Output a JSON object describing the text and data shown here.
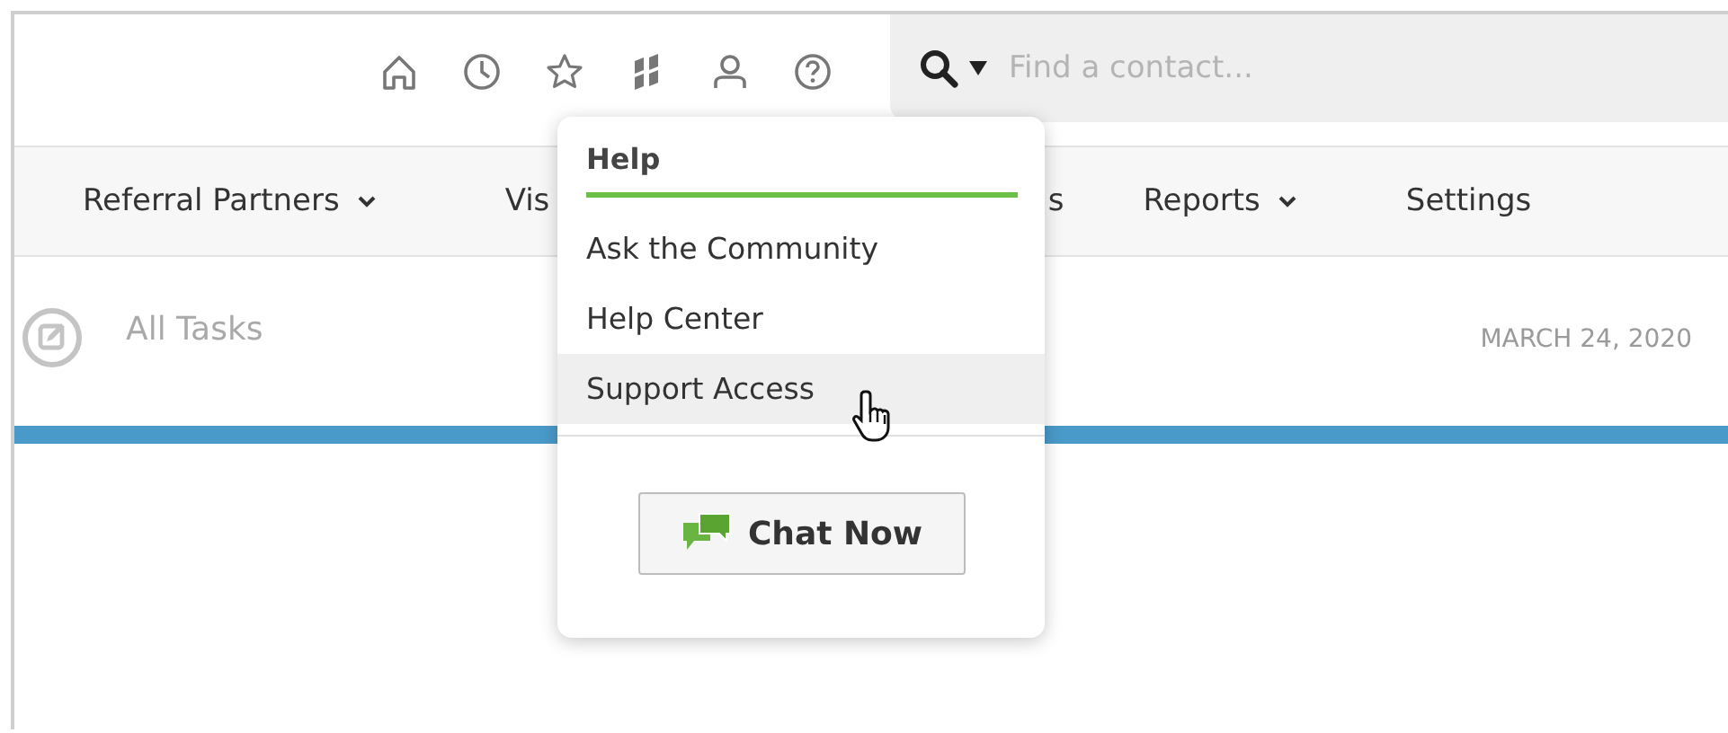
{
  "toolbar": {
    "icons": [
      {
        "kind": "home"
      },
      {
        "kind": "clock"
      },
      {
        "kind": "star"
      },
      {
        "kind": "apps"
      },
      {
        "kind": "person"
      },
      {
        "kind": "help"
      }
    ]
  },
  "search": {
    "placeholder": "Find a contact..."
  },
  "nav": [
    {
      "label": "Referral Partners",
      "dropdown": true,
      "kind": "full"
    },
    {
      "label": "Vis",
      "dropdown": false,
      "kind": "cut_right"
    },
    {
      "label": "s",
      "dropdown": false,
      "kind": "cut_left"
    },
    {
      "label": "Reports",
      "dropdown": true,
      "kind": "full"
    },
    {
      "label": "Settings",
      "dropdown": false,
      "kind": "full"
    }
  ],
  "tasks": {
    "title": "All Tasks",
    "date": "MARCH 24, 2020"
  },
  "help_menu": {
    "title": "Help",
    "items": [
      {
        "label": "Ask the Community",
        "selected": false
      },
      {
        "label": "Help Center",
        "selected": false
      },
      {
        "label": "Support Access",
        "selected": true
      }
    ],
    "button": "Chat Now"
  }
}
